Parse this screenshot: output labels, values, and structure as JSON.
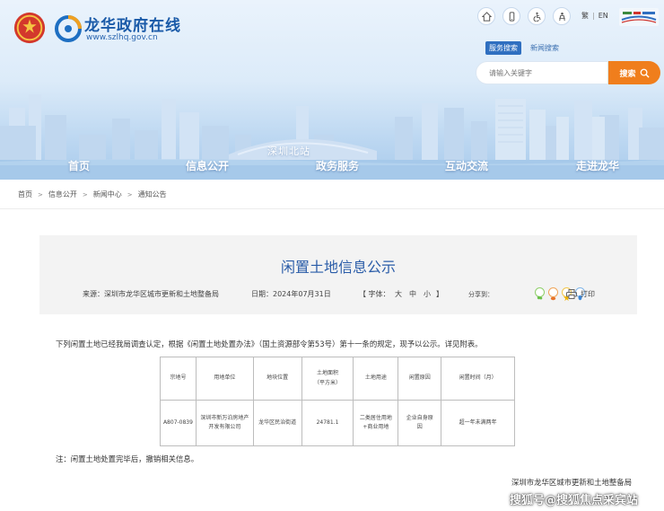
{
  "header": {
    "site_title": "龙华政府在线",
    "site_domain": "www.szlhq.gov.cn",
    "top_icons": [
      "home-icon",
      "mobile-icon",
      "accessibility-icon",
      "elderly-icon"
    ],
    "lang_1": "繁",
    "lang_sep": "|",
    "lang_2": "EN",
    "search_tabs": [
      "服务搜索",
      "新闻搜索"
    ],
    "search_placeholder": "请输入关键字",
    "search_button": "搜索",
    "nav": [
      "首页",
      "信息公开",
      "政务服务",
      "互动交流",
      "走进龙华"
    ],
    "banner_caption": "深圳北站"
  },
  "breadcrumb": [
    "首页",
    "信息公开",
    "新闻中心",
    "通知公告"
  ],
  "article": {
    "title": "闲置土地信息公示",
    "source": "来源：深圳市龙华区城市更新和土地整备局",
    "date": "日期：2024年07月31日",
    "font_label": "【 字体：",
    "font_large": "大",
    "font_medium": "中",
    "font_small": "小",
    "font_close": "】",
    "share_label": "分享到：",
    "print_label": "打印",
    "intro": "下列闲置土地已经我局调查认定，根据《闲置土地处置办法》（国土资源部令第53号）第十一条的规定，现予以公示。详见附表。",
    "note": "注：闲置土地处置完毕后，撤销相关信息。",
    "signature": "深圳市龙华区城市更新和土地整备局"
  },
  "table": {
    "headers": [
      "宗地号",
      "用地单位",
      "地块位置",
      "土地面积",
      "土地用途",
      "闲置原因",
      "闲置时间（月）"
    ],
    "area_unit": "（平方米）",
    "row": {
      "parcel": "A807-0839",
      "unit_line1": "深圳市新万泊房地产",
      "unit_line2": "开发有限公司",
      "location": "龙华区民治街道",
      "area": "24781.1",
      "use_line1": "二类居住用地",
      "use_line2": "+商业用地",
      "reason_line1": "企业自身原",
      "reason_line2": "因",
      "time": "超一年未满两年"
    }
  },
  "watermark": "搜狐号@搜狐焦点采宾站",
  "colors": {
    "brand_blue": "#2a5ca8",
    "search_orange": "#f07e1c",
    "card_gray": "#f3f3f3"
  }
}
